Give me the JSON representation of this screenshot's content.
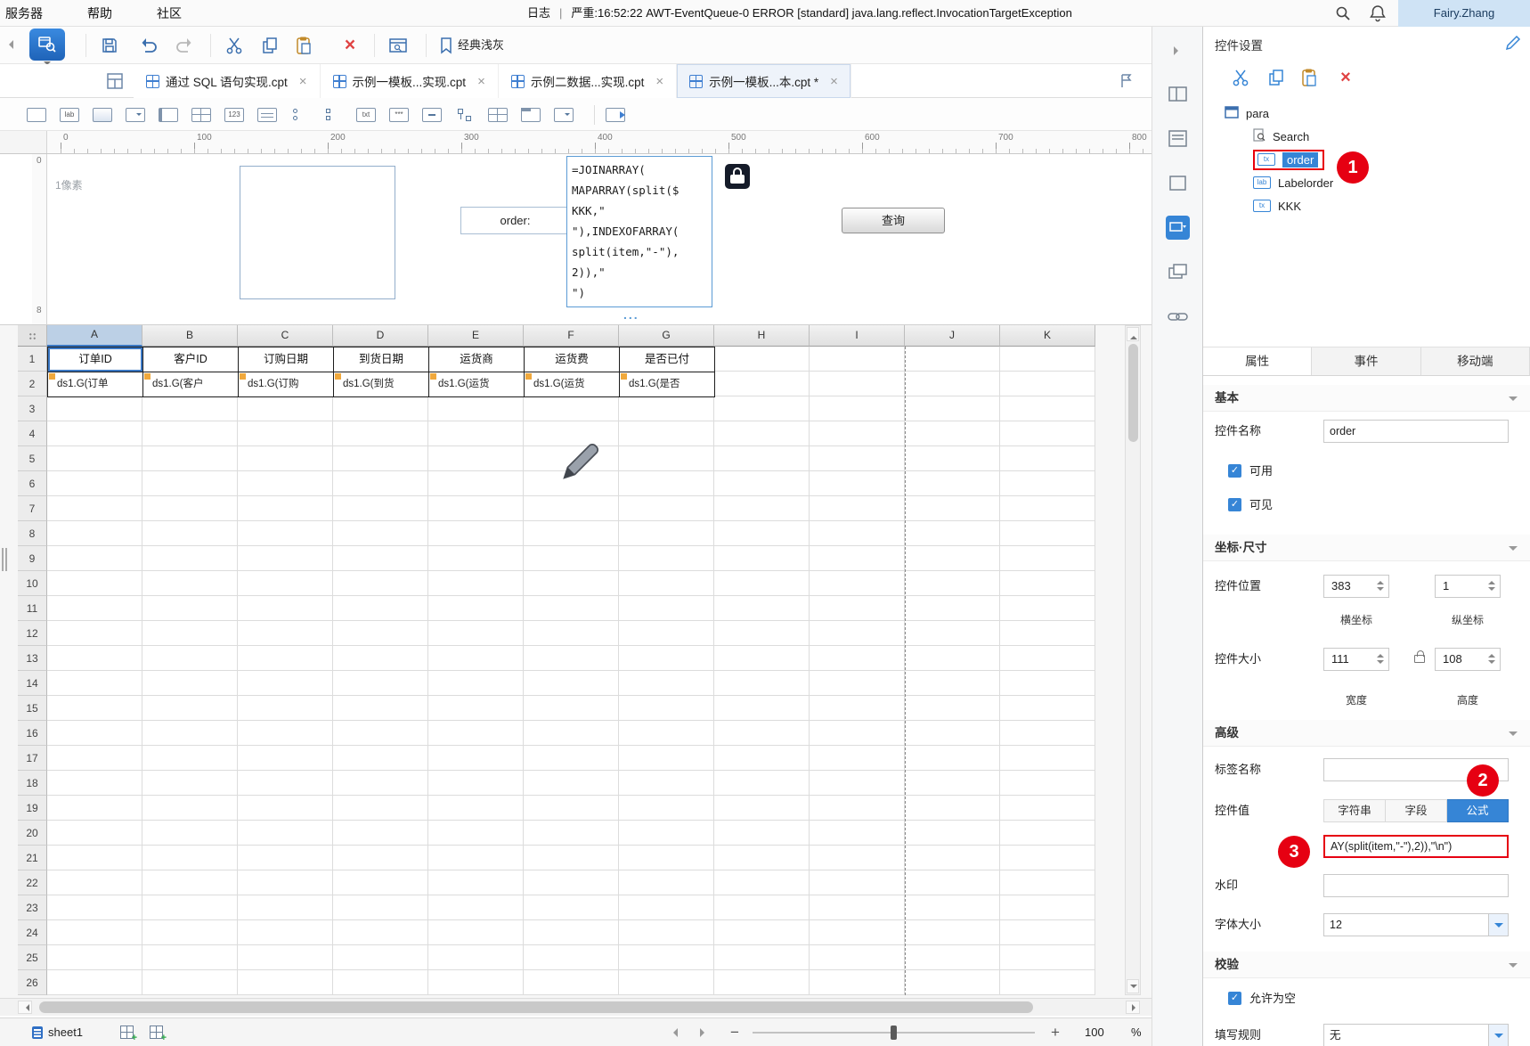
{
  "colors": {
    "accent_blue": "#3685d6",
    "annotation_red": "#e60012",
    "selection_blue": "#3b78c4",
    "user_chip_bg": "#cfe3f5"
  },
  "menubar": {
    "items": [
      "服务器",
      "帮助",
      "社区"
    ],
    "log_label": "日志",
    "log_message": "严重:16:52:22 AWT-EventQueue-0 ERROR [standard] java.lang.reflect.InvocationTargetException",
    "user": "Fairy.Zhang"
  },
  "toolbar": {
    "theme_label": "经典浅灰"
  },
  "tabs": [
    {
      "label": "通过 SQL 语句实现.cpt",
      "active": false
    },
    {
      "label": "示例一模板...实现.cpt",
      "active": false
    },
    {
      "label": "示例二数据...实现.cpt",
      "active": false
    },
    {
      "label": "示例一模板...本.cpt *",
      "active": true
    }
  ],
  "widgetbar": {
    "icons": [
      {
        "name": "text-widget-icon",
        "variant": "box"
      },
      {
        "name": "label-widget-icon",
        "variant": "text",
        "glyph": "lab"
      },
      {
        "name": "button-widget-icon",
        "variant": "button"
      },
      {
        "name": "combobox-widget-icon",
        "variant": "combo"
      },
      {
        "name": "layout-widget-icon",
        "variant": "corner"
      },
      {
        "name": "date-widget-icon",
        "variant": "grid"
      },
      {
        "name": "number-widget-icon",
        "variant": "text",
        "glyph": "123"
      },
      {
        "name": "textarea-widget-icon",
        "variant": "lines"
      },
      {
        "name": "radiogroup-widget-icon",
        "variant": "radio"
      },
      {
        "name": "checkboxgroup-widget-icon",
        "variant": "checks"
      },
      {
        "name": "textfield-widget-icon",
        "variant": "text",
        "glyph": "txt"
      },
      {
        "name": "password-widget-icon",
        "variant": "text",
        "glyph": "***"
      },
      {
        "name": "checkbox-widget-icon",
        "variant": "checkdash"
      },
      {
        "name": "treecombo-widget-icon",
        "variant": "tree"
      },
      {
        "name": "table-widget-icon",
        "variant": "grid"
      },
      {
        "name": "tab-layout-widget-icon",
        "variant": "tabs"
      },
      {
        "name": "combocheck-widget-icon",
        "variant": "combo"
      },
      {
        "name": "separator",
        "variant": "sep"
      },
      {
        "name": "report-block-widget-icon",
        "variant": "page"
      }
    ]
  },
  "ruler": {
    "h_ticks": [
      "0",
      "100",
      "200",
      "300",
      "400",
      "500",
      "600",
      "700",
      "800"
    ],
    "v_top": "0",
    "v_bottom": "8",
    "hint": "1像素"
  },
  "canvas": {
    "order_label": "order:",
    "formula_lines": [
      "=JOINARRAY(",
      "MAPARRAY(split($",
      "KKK,\"",
      "\"),INDEXOFARRAY(",
      "split(item,\"-\"),",
      "2)),\"",
      "\")"
    ],
    "query_button": "查询",
    "ellipsis": "..."
  },
  "grid": {
    "columns": [
      "A",
      "B",
      "C",
      "D",
      "E",
      "F",
      "G",
      "H",
      "I",
      "J",
      "K"
    ],
    "selected_column": "A",
    "row_count": 26,
    "header_row": [
      "订单ID",
      "客户ID",
      "订购日期",
      "到货日期",
      "运货商",
      "运货费",
      "是否已付"
    ],
    "data_row": [
      "ds1.G(订单",
      "ds1.G(客户",
      "ds1.G(订购",
      "ds1.G(到货",
      "ds1.G(运货",
      "ds1.G(运货",
      "ds1.G(是否"
    ]
  },
  "statusbar": {
    "sheet": "sheet1",
    "zoom": "100",
    "percent": "%"
  },
  "panel": {
    "title": "控件设置",
    "tree": {
      "root": "para",
      "items": [
        {
          "label": "Search",
          "icon": "search",
          "selected": false
        },
        {
          "label": "order",
          "icon": "tx",
          "selected": true
        },
        {
          "label": "Labelorder",
          "icon": "lab",
          "selected": false
        },
        {
          "label": "KKK",
          "icon": "tx",
          "selected": false
        }
      ]
    },
    "tabs": [
      {
        "label": "属性",
        "active": true
      },
      {
        "label": "事件",
        "active": false
      },
      {
        "label": "移动端",
        "active": false
      }
    ],
    "basic": {
      "title": "基本",
      "name_label": "控件名称",
      "name_value": "order",
      "enabled_label": "可用",
      "visible_label": "可见"
    },
    "coords": {
      "title": "坐标·尺寸",
      "pos_label": "控件位置",
      "pos_x": "383",
      "pos_y": "1",
      "x_axis_label": "横坐标",
      "y_axis_label": "纵坐标",
      "size_label": "控件大小",
      "width": "111",
      "height": "108",
      "width_label": "宽度",
      "height_label": "高度"
    },
    "advanced": {
      "title": "高级",
      "tag_label": "标签名称",
      "value_label": "控件值",
      "value_types": [
        "字符串",
        "字段",
        "公式"
      ],
      "value_selected": "公式",
      "formula_value": "AY(split(item,\"-\"),2)),\"\\n\")",
      "watermark_label": "水印",
      "fontsize_label": "字体大小",
      "fontsize_value": "12"
    },
    "validate": {
      "title": "校验",
      "allow_empty_label": "允许为空",
      "rule_label": "填写规则",
      "rule_value": "无"
    },
    "badges": [
      "1",
      "2",
      "3"
    ]
  }
}
